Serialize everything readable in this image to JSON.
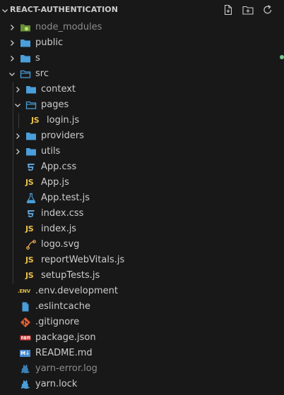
{
  "explorer": {
    "title": "REACT-AUTHENTICATION",
    "actions": [
      "new-file",
      "new-folder",
      "refresh"
    ]
  },
  "tree": [
    {
      "label": "node_modules",
      "type": "folder",
      "state": "collapsed",
      "icon": "node-folder-icon",
      "muted": true
    },
    {
      "label": "public",
      "type": "folder",
      "state": "collapsed",
      "icon": "folder-icon"
    },
    {
      "label": "s",
      "type": "folder",
      "state": "collapsed",
      "icon": "folder-icon"
    },
    {
      "label": "src",
      "type": "folder",
      "state": "expanded",
      "icon": "folder-open-icon"
    },
    {
      "label": "context",
      "type": "folder",
      "state": "collapsed",
      "icon": "folder-icon"
    },
    {
      "label": "pages",
      "type": "folder",
      "state": "expanded",
      "icon": "folder-open-icon"
    },
    {
      "label": "login.js",
      "type": "file",
      "icon": "js-file-icon"
    },
    {
      "label": "providers",
      "type": "folder",
      "state": "collapsed",
      "icon": "folder-icon"
    },
    {
      "label": "utils",
      "type": "folder",
      "state": "collapsed",
      "icon": "folder-icon"
    },
    {
      "label": "App.css",
      "type": "file",
      "icon": "css-file-icon"
    },
    {
      "label": "App.js",
      "type": "file",
      "icon": "js-file-icon"
    },
    {
      "label": "App.test.js",
      "type": "file",
      "icon": "test-flask-icon"
    },
    {
      "label": "index.css",
      "type": "file",
      "icon": "css-file-icon"
    },
    {
      "label": "index.js",
      "type": "file",
      "icon": "js-file-icon"
    },
    {
      "label": "logo.svg",
      "type": "file",
      "icon": "svg-file-icon"
    },
    {
      "label": "reportWebVitals.js",
      "type": "file",
      "icon": "js-file-icon"
    },
    {
      "label": "setupTests.js",
      "type": "file",
      "icon": "js-file-icon"
    },
    {
      "label": ".env.development",
      "type": "file",
      "icon": "env-file-icon"
    },
    {
      "label": ".eslintcache",
      "type": "file",
      "icon": "blank-file-icon"
    },
    {
      "label": ".gitignore",
      "type": "file",
      "icon": "git-file-icon"
    },
    {
      "label": "package.json",
      "type": "file",
      "icon": "npm-file-icon"
    },
    {
      "label": "README.md",
      "type": "file",
      "icon": "markdown-file-icon"
    },
    {
      "label": "yarn-error.log",
      "type": "file",
      "icon": "yarn-file-icon",
      "muted": true
    },
    {
      "label": "yarn.lock",
      "type": "file",
      "icon": "yarn-file-icon"
    }
  ],
  "badges": {
    "js_text": "JS",
    "env_text": ".ENV",
    "md_text": "M↓"
  },
  "colors": {
    "background": "#181818",
    "folder": "#4a9eda",
    "js": "#e8c04a",
    "css": "#5fa3d8",
    "git": "#e35d32",
    "npm": "#cb3837",
    "yarn": "#4a9eda",
    "svg": "#e8a54a",
    "git_modified_dot": "#73c991"
  }
}
